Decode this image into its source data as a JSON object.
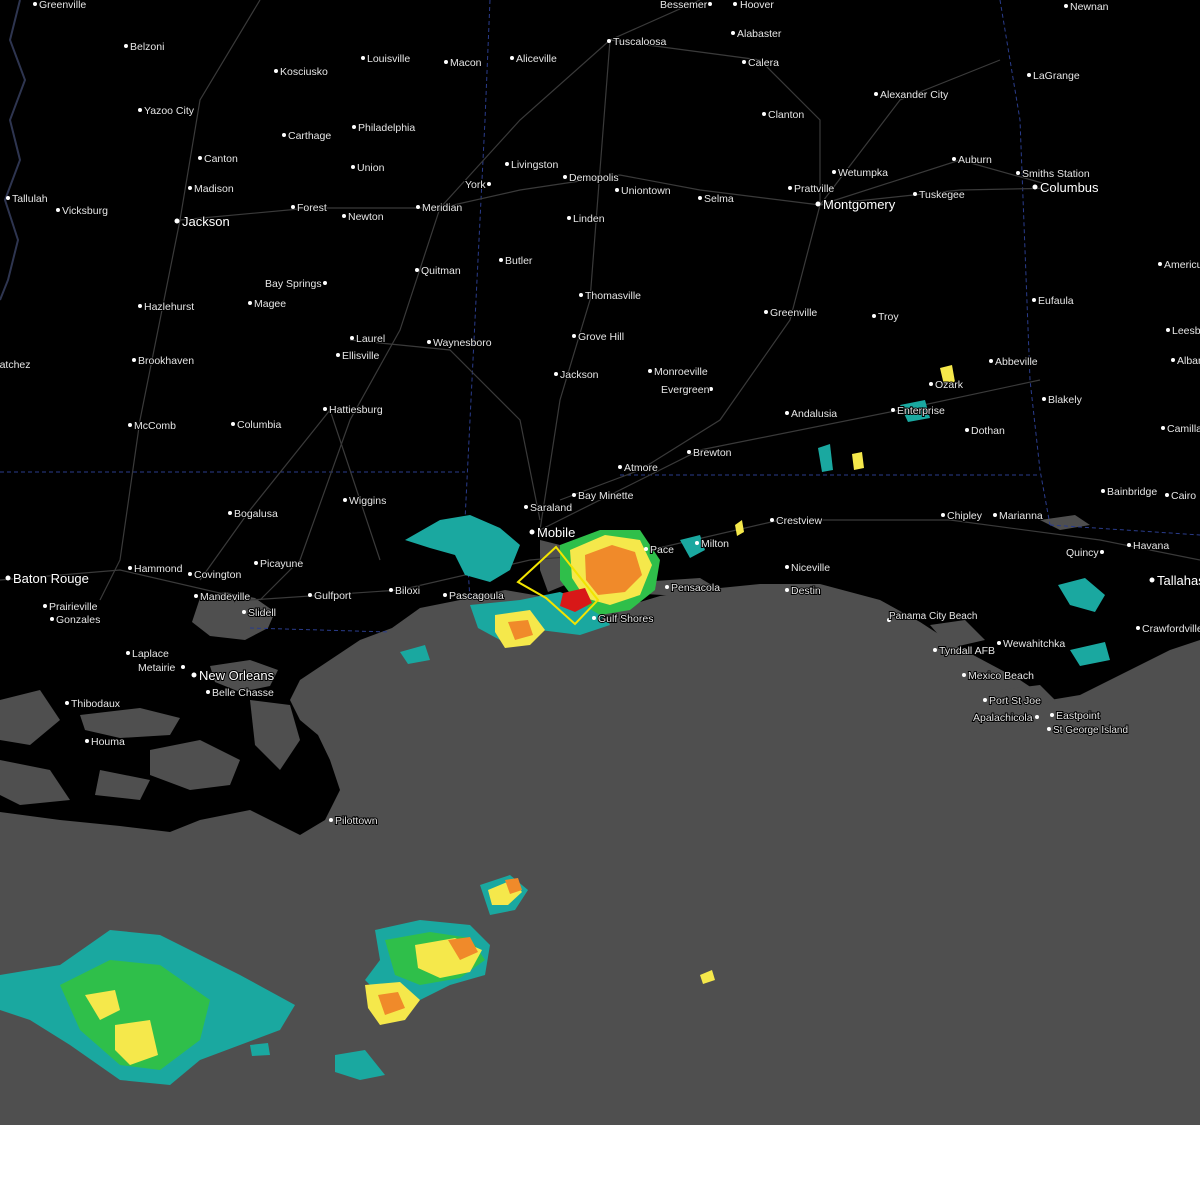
{
  "map": {
    "colors": {
      "land": "#000000",
      "water": "#4f4f4f",
      "roads": "#3a3a3a",
      "state_border": "#2a3c8c",
      "labels": "#e6e6e6",
      "warning_polygon": "#f2e400",
      "radar_light": "#1aa8a0",
      "radar_green": "#2fbf4a",
      "radar_yellow": "#f5e84b",
      "radar_orange": "#f08a2a",
      "radar_red": "#d81818"
    },
    "cities": [
      {
        "name": "Greenville"
      },
      {
        "name": "Bessemer"
      },
      {
        "name": "Hoover"
      },
      {
        "name": "Newnan"
      },
      {
        "name": "Belzoni"
      },
      {
        "name": "Louisville"
      },
      {
        "name": "Macon"
      },
      {
        "name": "Aliceville"
      },
      {
        "name": "Tuscaloosa"
      },
      {
        "name": "Alabaster"
      },
      {
        "name": "Calera"
      },
      {
        "name": "LaGrange"
      },
      {
        "name": "Kosciusko"
      },
      {
        "name": "Yazoo City"
      },
      {
        "name": "Philadelphia"
      },
      {
        "name": "Clanton"
      },
      {
        "name": "Alexander City"
      },
      {
        "name": "Carthage"
      },
      {
        "name": "Canton"
      },
      {
        "name": "Union"
      },
      {
        "name": "Livingston"
      },
      {
        "name": "Demopolis"
      },
      {
        "name": "Wetumpka"
      },
      {
        "name": "Auburn"
      },
      {
        "name": "Smiths Station"
      },
      {
        "name": "Madison"
      },
      {
        "name": "York"
      },
      {
        "name": "Uniontown"
      },
      {
        "name": "Prattville"
      },
      {
        "name": "Tuskegee"
      },
      {
        "name": "Columbus"
      },
      {
        "name": "Tallulah"
      },
      {
        "name": "Vicksburg"
      },
      {
        "name": "Jackson"
      },
      {
        "name": "Forest"
      },
      {
        "name": "Newton"
      },
      {
        "name": "Meridian"
      },
      {
        "name": "Linden"
      },
      {
        "name": "Selma"
      },
      {
        "name": "Montgomery"
      },
      {
        "name": "Butler"
      },
      {
        "name": "Quitman"
      },
      {
        "name": "Americus"
      },
      {
        "name": "Bay Springs"
      },
      {
        "name": "Thomasville"
      },
      {
        "name": "Eufaula"
      },
      {
        "name": "Hazlehurst"
      },
      {
        "name": "Magee"
      },
      {
        "name": "Greenville"
      },
      {
        "name": "Troy"
      },
      {
        "name": "Leesburg"
      },
      {
        "name": "Laurel"
      },
      {
        "name": "Waynesboro"
      },
      {
        "name": "Grove Hill"
      },
      {
        "name": "Ellisville"
      },
      {
        "name": "Brookhaven"
      },
      {
        "name": "Abbeville"
      },
      {
        "name": "Albany"
      },
      {
        "name": "Jackson"
      },
      {
        "name": "Monroeville"
      },
      {
        "name": "Ozark"
      },
      {
        "name": "Natchez"
      },
      {
        "name": "Evergreen"
      },
      {
        "name": "Blakely"
      },
      {
        "name": "Hattiesburg"
      },
      {
        "name": "Andalusia"
      },
      {
        "name": "Enterprise"
      },
      {
        "name": "McComb"
      },
      {
        "name": "Columbia"
      },
      {
        "name": "Camilla"
      },
      {
        "name": "Dothan"
      },
      {
        "name": "Brewton"
      },
      {
        "name": "Atmore"
      },
      {
        "name": "Bay Minette"
      },
      {
        "name": "Bainbridge"
      },
      {
        "name": "Cairo"
      },
      {
        "name": "Wiggins"
      },
      {
        "name": "Saraland"
      },
      {
        "name": "Bogalusa"
      },
      {
        "name": "Crestview"
      },
      {
        "name": "Mobile"
      },
      {
        "name": "Chipley"
      },
      {
        "name": "Marianna"
      },
      {
        "name": "Pace"
      },
      {
        "name": "Milton"
      },
      {
        "name": "Quincy"
      },
      {
        "name": "Havana"
      },
      {
        "name": "Picayune"
      },
      {
        "name": "Hammond"
      },
      {
        "name": "Covington"
      },
      {
        "name": "Baton Rouge"
      },
      {
        "name": "Niceville"
      },
      {
        "name": "Tallahassee"
      },
      {
        "name": "Gulfport"
      },
      {
        "name": "Biloxi"
      },
      {
        "name": "Pascagoula"
      },
      {
        "name": "Pensacola"
      },
      {
        "name": "Destin"
      },
      {
        "name": "Prairieville"
      },
      {
        "name": "Mandeville"
      },
      {
        "name": "Slidell"
      },
      {
        "name": "Gulf Shores"
      },
      {
        "name": "Gonzales"
      },
      {
        "name": "Panama City Beach"
      },
      {
        "name": "Crawfordville"
      },
      {
        "name": "Wewahitchka"
      },
      {
        "name": "Laplace"
      },
      {
        "name": "Tyndall AFB"
      },
      {
        "name": "Metairie"
      },
      {
        "name": "New Orleans"
      },
      {
        "name": "Belle Chasse"
      },
      {
        "name": "Mexico Beach"
      },
      {
        "name": "Port St Joe"
      },
      {
        "name": "Thibodaux"
      },
      {
        "name": "Eastpoint"
      },
      {
        "name": "Apalachicola"
      },
      {
        "name": "St George Island"
      },
      {
        "name": "Houma"
      },
      {
        "name": "Pilottown"
      }
    ]
  }
}
